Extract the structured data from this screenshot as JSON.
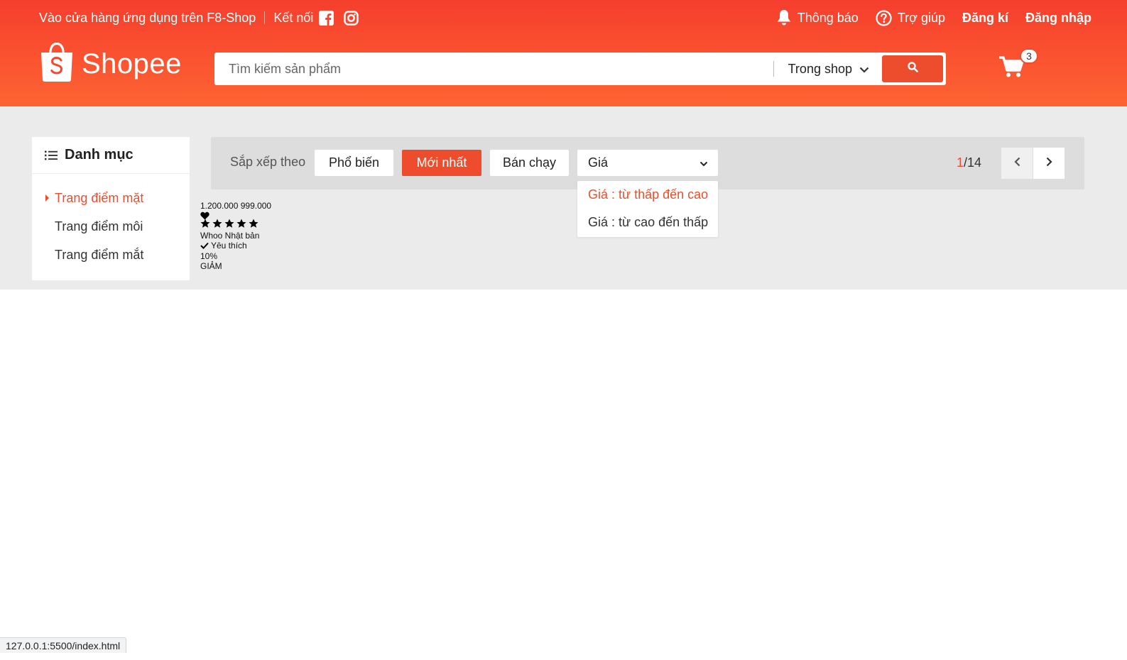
{
  "colors": {
    "brand": "#ee4d2d",
    "header_gradient_top": "#f53e2d",
    "header_gradient_bottom": "#fe6433",
    "content_bg": "#ebebeb"
  },
  "topbar": {
    "download_app": "Vào cửa hàng ứng dụng trên F8-Shop",
    "connect": "Kết nối",
    "icons": [
      "facebook-icon",
      "instagram-icon"
    ],
    "notifications": "Thông báo",
    "help": "Trợ giúp",
    "register": "Đăng kí",
    "login": "Đăng nhập"
  },
  "logo": {
    "text": "Shopee"
  },
  "search": {
    "placeholder": "Tìm kiếm sản phẩm",
    "scope": "Trong shop"
  },
  "cart": {
    "count": "3"
  },
  "category": {
    "title": "Danh mục",
    "items": [
      {
        "label": "Trang điểm mặt",
        "active": true
      },
      {
        "label": "Trang điểm môi",
        "active": false
      },
      {
        "label": "Trang điểm mắt",
        "active": false
      }
    ]
  },
  "filter": {
    "label": "Sắp xếp theo",
    "buttons": [
      "Phổ biến",
      "Mới nhất",
      "Bán chạy"
    ],
    "active_button": "Mới nhất",
    "price_select": "Giá",
    "price_options": [
      "Giá : từ thấp đến cao",
      "Giá : từ cao đến thấp"
    ],
    "page_current": "1",
    "page_total": "/14"
  },
  "product": {
    "prices": "1.200.000 999.000",
    "rating_stars": 5,
    "brand": "Whoo Nhật bản",
    "favorite": "Yêu thích",
    "discount_percent": "10%",
    "discount_label": "GIẢM"
  },
  "statusbar": {
    "url": "127.0.0.1:5500/index.html"
  }
}
